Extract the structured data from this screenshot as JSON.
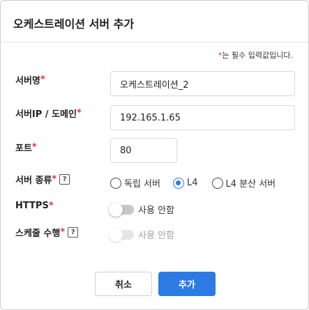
{
  "dialog": {
    "title": "오케스트레이션 서버 추가",
    "required_note_star": "*",
    "required_note": "는 필수 입력값입니다."
  },
  "fields": {
    "server_name": {
      "label": "서버명",
      "required": "*",
      "value": "오케스트레이션_2"
    },
    "server_ip": {
      "label": "서버IP / 도메인",
      "required": "*",
      "value": "192.165.1.65"
    },
    "port": {
      "label": "포트",
      "required": "*",
      "value": "80"
    },
    "server_type": {
      "label": "서버 종류",
      "required": "*",
      "help": "?",
      "options": [
        "독립 서버",
        "L4",
        "L4 분산 서버"
      ],
      "selected": "L4"
    },
    "https": {
      "label": "HTTPS",
      "required": "*",
      "toggle_text": "사용 안함",
      "enabled": false
    },
    "schedule": {
      "label": "스케줄 수행",
      "required": "*",
      "help": "?",
      "toggle_text": "사용 안함",
      "enabled": false,
      "disabled": true
    }
  },
  "buttons": {
    "cancel": "취소",
    "add": "추가"
  },
  "colors": {
    "accent": "#2c7be5",
    "required": "#e0333a",
    "toggle_off": "#c8c8c8"
  }
}
